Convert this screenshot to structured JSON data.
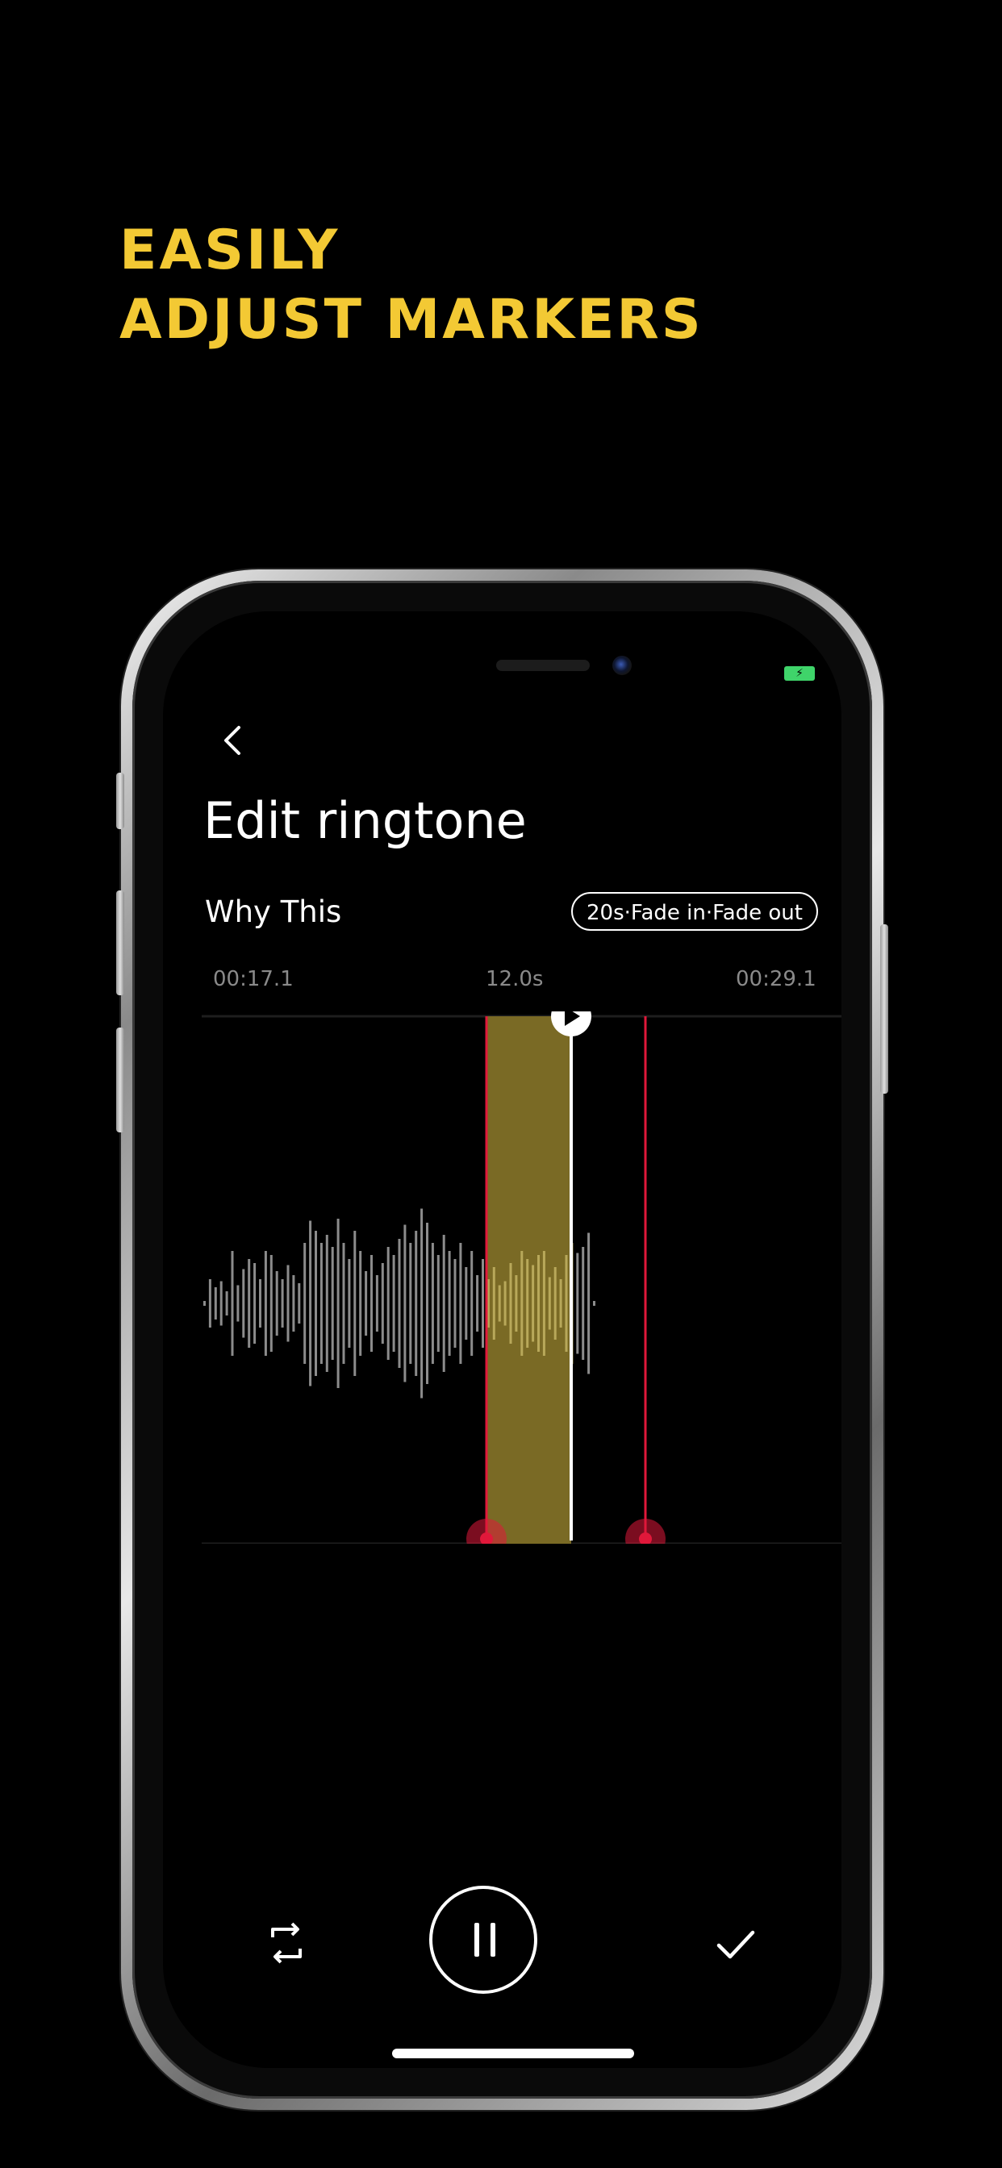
{
  "headline": {
    "line1": "EASILY",
    "line2": "ADJUST MARKERS"
  },
  "status": {
    "battery_icon": "battery-charging-icon"
  },
  "editor": {
    "back_icon": "chevron-left-icon",
    "title": "Edit ringtone",
    "song_name": "Why This",
    "fade_badge": "20s·Fade in·Fade out",
    "time_start": "00:17.1",
    "duration": "12.0s",
    "time_end": "00:29.1"
  },
  "controls": {
    "loop_icon": "loop-icon",
    "pause_icon": "pause-icon",
    "confirm_icon": "checkmark-icon"
  },
  "colors": {
    "accent": "#f3c934",
    "marker": "#e0183a",
    "selection": "#7a6a25",
    "waveform": "#8c8c8c",
    "battery": "#3fd46a"
  }
}
